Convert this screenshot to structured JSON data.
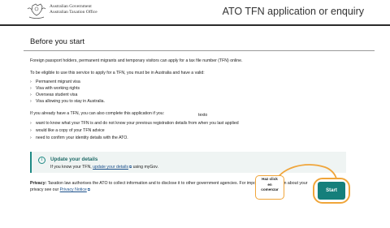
{
  "header": {
    "gov_line1": "Australian Government",
    "gov_line2": "Australian Taxation Office",
    "app_title": "ATO TFN application or enquiry",
    "crest_icon": "coat-of-arms-icon"
  },
  "main": {
    "title": "Before you start",
    "intro": "Foreign passport holders, permanent migrants and temporary visitors can apply for a tax file number (TFN) online.",
    "eligibility_lead": "To be eligible to use this service to apply for a TFN, you must be in Australia and have a valid:",
    "visa_list": [
      "Permanent migrant visa",
      "Visa with working rights",
      "Overseas student visa",
      "Visa allowing you to stay in Australia."
    ],
    "existing_lead": "If you already have a TFN, you can also complete this application if you:",
    "floating_word": "texto",
    "existing_list": [
      "want to know what your TFN is and do not know your previous registration details from when you last applied",
      "would like a copy of your TFN advice",
      "need to confirm your identity details with the ATO."
    ],
    "callout": {
      "title": "Update your details",
      "body_prefix": "If you know your TFN,",
      "link_text": "update your details",
      "body_suffix": "using myGov."
    },
    "privacy": {
      "label": "Privacy:",
      "line1": "Taxation law authorises the ATO to collect information and to disclose it to other government agencies. For important information about your",
      "line2_prefix": "privacy see our",
      "link_text": "Privacy Notice"
    },
    "start_label": "Start"
  },
  "annotation": {
    "lines": [
      "Haz click",
      "en",
      "comenzar"
    ],
    "color": "#f0a53a"
  },
  "colors": {
    "accent": "#157f7b",
    "link": "#1a4f8b",
    "callout_bg": "#eff4f3"
  }
}
